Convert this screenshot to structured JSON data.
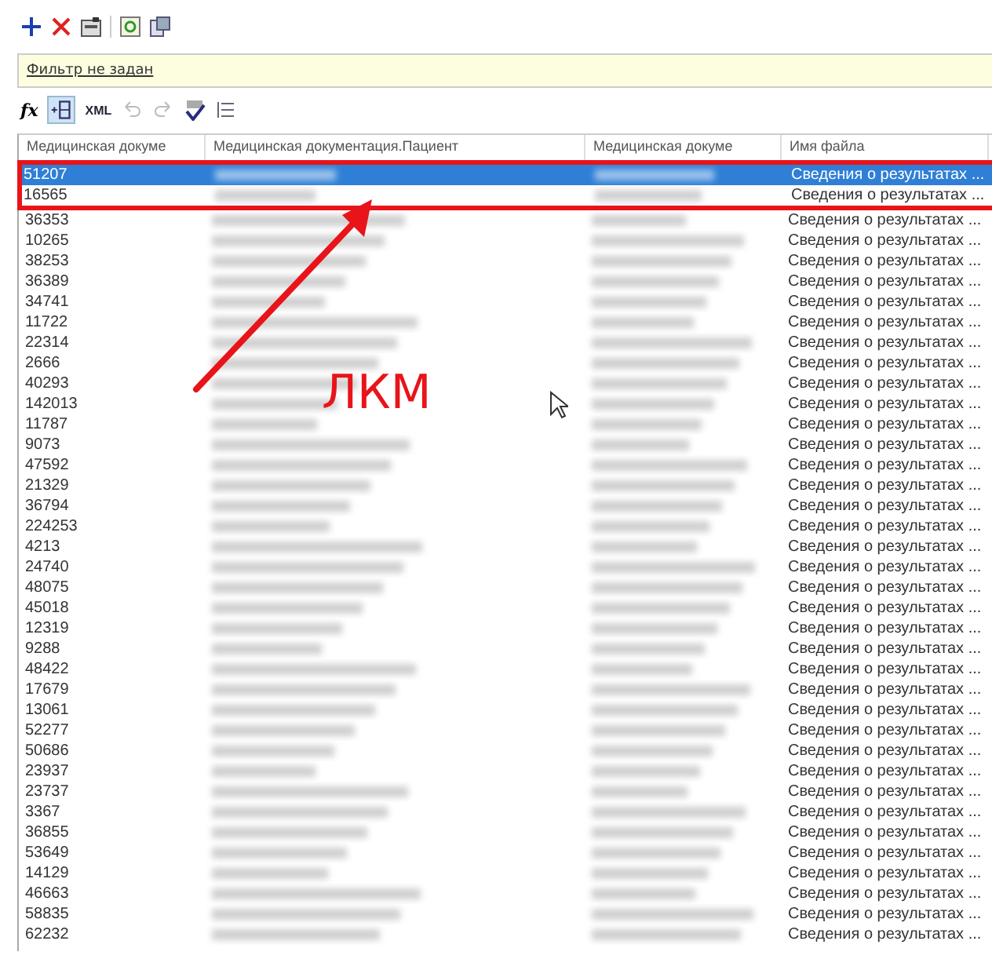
{
  "filter": {
    "text": "Фильтр не задан"
  },
  "toolbar2": {
    "fx": "fx",
    "xml": "XML"
  },
  "table": {
    "columns": [
      "Медицинская докуме",
      "Медицинская документация.Пациент",
      "Медицинская докуме",
      "Имя файла"
    ],
    "rows": [
      {
        "id": "51207",
        "file": "Сведения о результатах ...",
        "selected": true
      },
      {
        "id": "16565",
        "file": "Сведения о результатах ...",
        "selected": false
      },
      {
        "id": "36353",
        "file": "Сведения о результатах ...",
        "selected": false
      },
      {
        "id": "10265",
        "file": "Сведения о результатах ...",
        "selected": false
      },
      {
        "id": "38253",
        "file": "Сведения о результатах ...",
        "selected": false
      },
      {
        "id": "36389",
        "file": "Сведения о результатах ...",
        "selected": false
      },
      {
        "id": "34741",
        "file": "Сведения о результатах ...",
        "selected": false
      },
      {
        "id": "11722",
        "file": "Сведения о результатах ...",
        "selected": false
      },
      {
        "id": "22314",
        "file": "Сведения о результатах ...",
        "selected": false
      },
      {
        "id": "2666",
        "file": "Сведения о результатах ...",
        "selected": false
      },
      {
        "id": "40293",
        "file": "Сведения о результатах ...",
        "selected": false
      },
      {
        "id": "142013",
        "file": "Сведения о результатах ...",
        "selected": false
      },
      {
        "id": "11787",
        "file": "Сведения о результатах ...",
        "selected": false
      },
      {
        "id": "9073",
        "file": "Сведения о результатах ...",
        "selected": false
      },
      {
        "id": "47592",
        "file": "Сведения о результатах ...",
        "selected": false
      },
      {
        "id": "21329",
        "file": "Сведения о результатах ...",
        "selected": false
      },
      {
        "id": "36794",
        "file": "Сведения о результатах ...",
        "selected": false
      },
      {
        "id": "224253",
        "file": "Сведения о результатах ...",
        "selected": false
      },
      {
        "id": "4213",
        "file": "Сведения о результатах ...",
        "selected": false
      },
      {
        "id": "24740",
        "file": "Сведения о результатах ...",
        "selected": false
      },
      {
        "id": "48075",
        "file": "Сведения о результатах ...",
        "selected": false
      },
      {
        "id": "45018",
        "file": "Сведения о результатах ...",
        "selected": false
      },
      {
        "id": "12319",
        "file": "Сведения о результатах ...",
        "selected": false
      },
      {
        "id": "9288",
        "file": "Сведения о результатах ...",
        "selected": false
      },
      {
        "id": "48422",
        "file": "Сведения о результатах ...",
        "selected": false
      },
      {
        "id": "17679",
        "file": "Сведения о результатах ...",
        "selected": false
      },
      {
        "id": "13061",
        "file": "Сведения о результатах ...",
        "selected": false
      },
      {
        "id": "52277",
        "file": "Сведения о результатах ...",
        "selected": false
      },
      {
        "id": "50686",
        "file": "Сведения о результатах ...",
        "selected": false
      },
      {
        "id": "23937",
        "file": "Сведения о результатах ...",
        "selected": false
      },
      {
        "id": "23737",
        "file": "Сведения о результатах ...",
        "selected": false
      },
      {
        "id": "3367",
        "file": "Сведения о результатах ...",
        "selected": false
      },
      {
        "id": "36855",
        "file": "Сведения о результатах ...",
        "selected": false
      },
      {
        "id": "53649",
        "file": "Сведения о результатах ...",
        "selected": false
      },
      {
        "id": "14129",
        "file": "Сведения о результатах ...",
        "selected": false
      },
      {
        "id": "46663",
        "file": "Сведения о результатах ...",
        "selected": false
      },
      {
        "id": "58835",
        "file": "Сведения о результатах ...",
        "selected": false
      },
      {
        "id": "62232",
        "file": "Сведения о результатах ...",
        "selected": false
      }
    ]
  },
  "annotation": {
    "label": "ЛКМ"
  }
}
